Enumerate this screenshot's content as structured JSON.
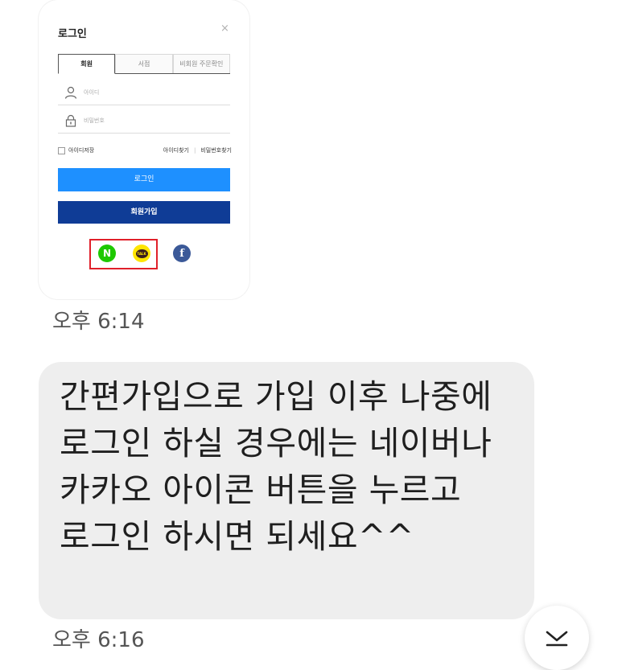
{
  "image_message": {
    "login": {
      "title": "로그인",
      "close": "×",
      "tabs": [
        {
          "label": "회원"
        },
        {
          "label": "서점"
        },
        {
          "label": "비회원 주문확인"
        }
      ],
      "id_placeholder": "아이디",
      "pw_placeholder": "비밀번호",
      "remember_label": "아이디저장",
      "find_id": "아이디찾기",
      "divider": "|",
      "find_pw": "비밀번호찾기",
      "login_button": "로그인",
      "join_button": "회원가입",
      "social": {
        "naver_letter": "N",
        "kakao_text": "TALK",
        "facebook_letter": "f"
      }
    },
    "time": "오후 6:14"
  },
  "text_message": {
    "text": "간편가입으로 가입 이후 나중에 로그인 하실 경우에는 네이버나 카카오 아이콘 버튼을 누르고 로그인 하시면 되세요^^",
    "time": "오후 6:16"
  },
  "colors": {
    "login_blue": "#1e90ff",
    "join_navy": "#0f3c96",
    "naver_green": "#1ec800",
    "kakao_yellow": "#fee500",
    "facebook_blue": "#3b5998",
    "highlight_red": "#e0202a",
    "bubble_gray": "#eeeeee"
  },
  "icons": [
    "user-icon",
    "lock-icon",
    "naver-icon",
    "kakao-talk-icon",
    "facebook-icon",
    "chevron-down-icon"
  ]
}
